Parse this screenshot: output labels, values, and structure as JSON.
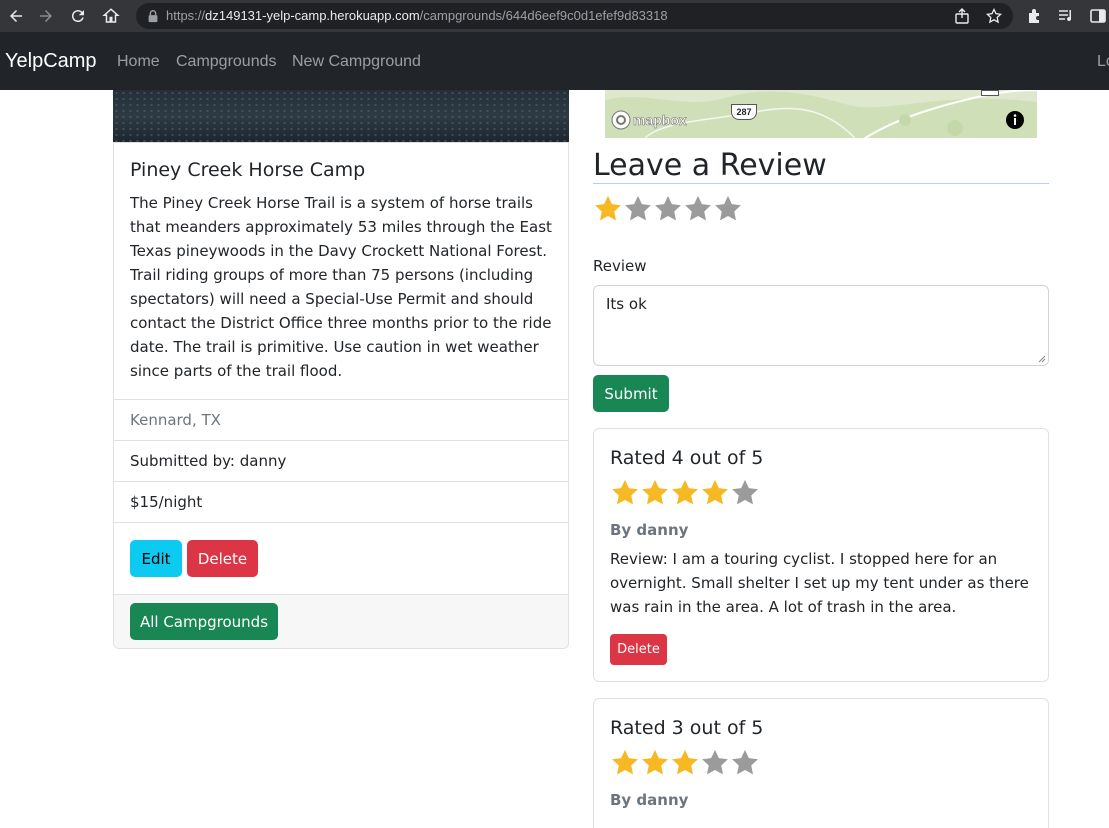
{
  "browser": {
    "url_prefix": "https://",
    "url_host": "dz149131-yelp-camp.herokuapp.com",
    "url_path": "/campgrounds/644d6eef9c0d1efef9d83318"
  },
  "navbar": {
    "brand": "YelpCamp",
    "links": [
      "Home",
      "Campgrounds",
      "New Campground"
    ],
    "right_link": "Lo"
  },
  "campground": {
    "title": "Piney Creek Horse Camp",
    "description": "The Piney Creek Horse Trail is a system of horse trails that meanders approximately 53 miles through the East Texas pineywoods in the Davy Crockett National Forest. Trail riding groups of more than 75 persons (including spectators) will need a Special-Use Permit and should contact the District Office three months prior to the ride date. The trail is primitive. Use caution in wet weather since parts of the trail flood.",
    "location": "Kennard, TX",
    "submitted_by": "Submitted by: danny",
    "price": "$15/night",
    "edit_label": "Edit",
    "delete_label": "Delete",
    "all_label": "All Campgrounds"
  },
  "map": {
    "attribution": "mapbox",
    "road_label": "287"
  },
  "review_form": {
    "heading": "Leave a Review",
    "rating": 1,
    "max_rating": 5,
    "label": "Review",
    "value": "Its ok",
    "submit_label": "Submit"
  },
  "reviews": [
    {
      "title": "Rated 4 out of 5",
      "rating": 4,
      "by": "By danny",
      "text": "Review: I am a touring cyclist. I stopped here for an overnight. Small shelter I set up my tent under as there was rain in the area. A lot of trash in the area.",
      "delete_label": "Delete"
    },
    {
      "title": "Rated 3 out of 5",
      "rating": 3,
      "by": "By danny"
    }
  ],
  "colors": {
    "star_on": "#f7b923",
    "star_off": "#9b9b9b",
    "success": "#198754",
    "info": "#0dcaf0",
    "danger": "#dc3545",
    "navbar": "#212529"
  }
}
